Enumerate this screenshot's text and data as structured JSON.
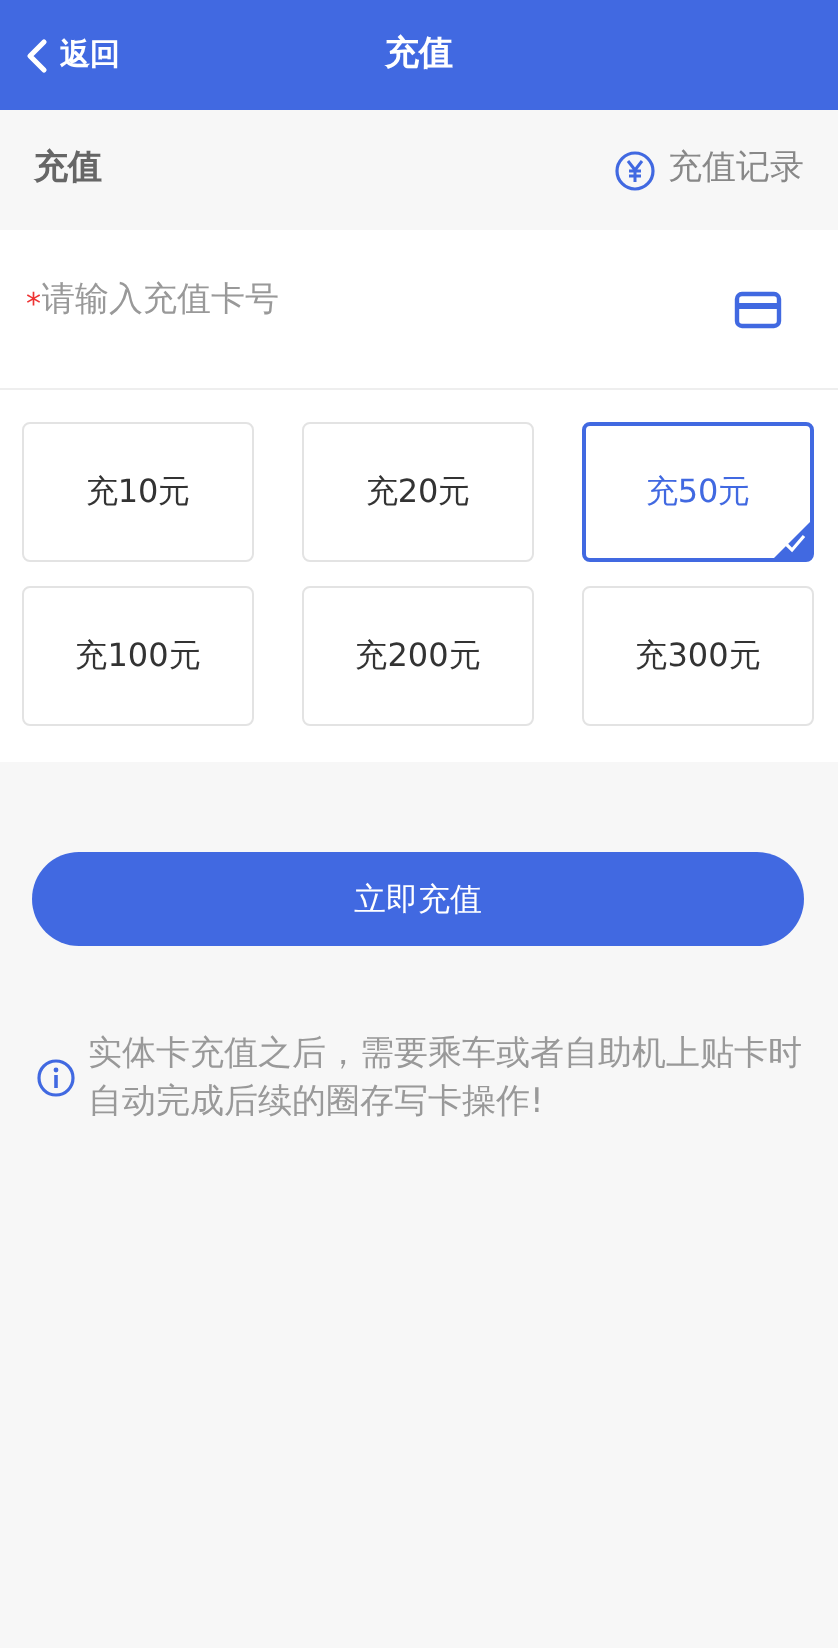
{
  "header": {
    "back_label": "返回",
    "title": "充值"
  },
  "section": {
    "title": "充值",
    "record_link": "充值记录"
  },
  "card_input": {
    "required_mark": "*",
    "placeholder": "请输入充值卡号"
  },
  "amounts": [
    {
      "label": "充10元",
      "selected": false
    },
    {
      "label": "充20元",
      "selected": false
    },
    {
      "label": "充50元",
      "selected": true
    },
    {
      "label": "充100元",
      "selected": false
    },
    {
      "label": "充200元",
      "selected": false
    },
    {
      "label": "充300元",
      "selected": false
    }
  ],
  "submit": "立即充值",
  "notice": "实体卡充值之后，需要乘车或者自助机上贴卡时自动完成后续的圈存写卡操作!"
}
